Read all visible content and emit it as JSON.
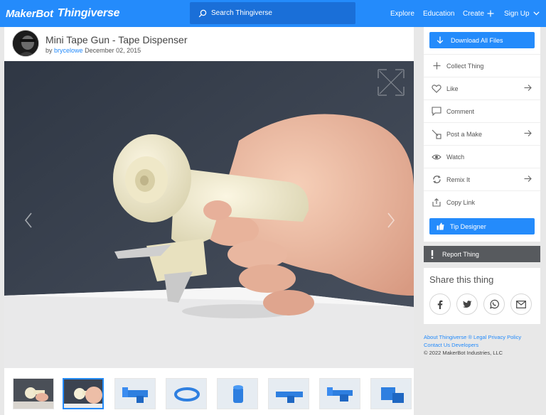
{
  "header": {
    "brand_part1": "MakerBot",
    "brand_part2": "Thingiverse",
    "search_placeholder": "Search Thingiverse",
    "nav": {
      "explore": "Explore",
      "education": "Education",
      "create": "Create",
      "signup": "Sign Up"
    }
  },
  "thing": {
    "title": "Mini Tape Gun - Tape Dispenser",
    "by_prefix": "by",
    "author": "brycelowe",
    "date": "December 02, 2015"
  },
  "sidebar": {
    "download_label": "Download All Files",
    "actions": {
      "collect": "Collect Thing",
      "like": "Like",
      "comment": "Comment",
      "post_make": "Post a Make",
      "watch": "Watch",
      "remix": "Remix It",
      "copy_link": "Copy Link"
    },
    "tip_label": "Tip Designer",
    "report_label": "Report Thing",
    "share_title": "Share this thing"
  },
  "footer": {
    "line1": "About Thingiverse ® Legal Privacy Policy",
    "line2": "Contact Us Developers",
    "copyright": "© 2022 MakerBot Industries, LLC"
  },
  "colors": {
    "brand_blue": "#248bfb",
    "report_gray": "#575a5e",
    "page_bg": "#e8e8e8"
  },
  "icons": {
    "search": "search-icon",
    "plus": "plus-icon",
    "chevron": "chevron-down-icon",
    "download": "download-arrow-icon",
    "collect": "plus-icon",
    "like": "heart-icon",
    "comment": "comment-icon",
    "make": "post-make-icon",
    "watch": "eye-icon",
    "remix": "remix-icon",
    "copy": "share-out-icon",
    "tip": "thumbs-up-icon",
    "report": "exclamation-icon",
    "facebook": "facebook-icon",
    "twitter": "twitter-icon",
    "whatsapp": "whatsapp-icon",
    "email": "email-icon"
  }
}
